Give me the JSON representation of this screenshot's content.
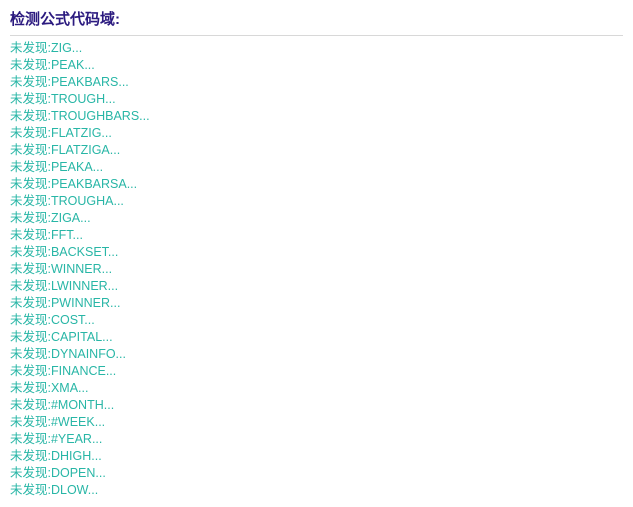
{
  "header": "检测公式代码域:",
  "prefix": "未发现:",
  "items": [
    "ZIG...",
    "PEAK...",
    "PEAKBARS...",
    "TROUGH...",
    "TROUGHBARS...",
    "FLATZIG...",
    "FLATZIGA...",
    "PEAKA...",
    "PEAKBARSA...",
    "TROUGHA...",
    "ZIGA...",
    "FFT...",
    "BACKSET...",
    "WINNER...",
    "LWINNER...",
    "PWINNER...",
    "COST...",
    "CAPITAL...",
    "DYNAINFO...",
    "FINANCE...",
    "XMA...",
    "#MONTH...",
    "#WEEK...",
    "#YEAR...",
    "DHIGH...",
    "DOPEN...",
    "DLOW..."
  ]
}
